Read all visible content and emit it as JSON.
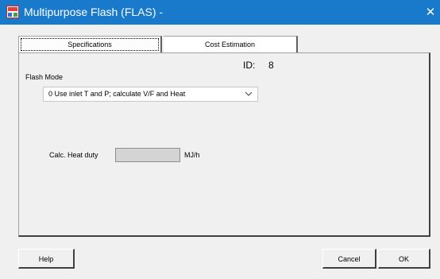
{
  "window": {
    "title": "Multipurpose Flash (FLAS) -",
    "close_glyph": "✕",
    "titlebar_color": "#1979ca",
    "app_icon": "app-icon"
  },
  "tabs": [
    {
      "label": "Specifications",
      "selected": true
    },
    {
      "label": "Cost Estimation",
      "selected": false
    }
  ],
  "specifications": {
    "id_label": "ID:",
    "id_value": "8",
    "flash_mode_label": "Flash Mode",
    "flash_mode_value": "0 Use inlet T and P; calculate V/F and Heat",
    "heat_duty_label": "Calc. Heat duty",
    "heat_duty_value": "",
    "heat_duty_unit": "MJ/h"
  },
  "buttons": {
    "help": "Help",
    "cancel": "Cancel",
    "ok": "OK"
  }
}
